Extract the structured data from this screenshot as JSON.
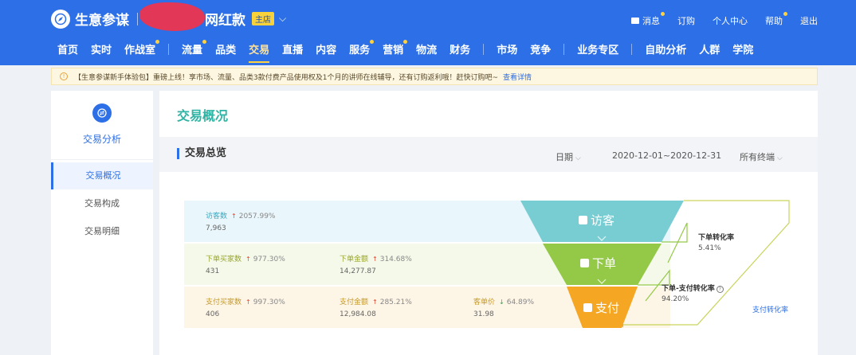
{
  "header": {
    "brand": "生意参谋",
    "shop_name_suffix": "网红款",
    "shop_badge": "主店",
    "user_nav": [
      "消息",
      "订购",
      "个人中心",
      "帮助",
      "退出"
    ]
  },
  "main_nav": {
    "group1": [
      "首页",
      "实时",
      "作战室"
    ],
    "group2": [
      "流量",
      "品类",
      "交易",
      "直播",
      "内容",
      "服务",
      "营销",
      "物流",
      "财务"
    ],
    "group3": [
      "市场",
      "竞争"
    ],
    "group4": [
      "业务专区"
    ],
    "group5": [
      "自助分析",
      "人群",
      "学院"
    ],
    "active": "交易"
  },
  "notice": {
    "text": "【生意参谋新手体验包】重磅上线！享市场、流量、品类3款付费产品使用权及1个月的讲师在线辅导，还有订购返利哦！赶快订购吧~",
    "link": "查看详情"
  },
  "sidebar": {
    "title": "交易分析",
    "items": [
      "交易概况",
      "交易构成",
      "交易明细"
    ],
    "active_index": 0
  },
  "content": {
    "page_title": "交易概况",
    "section_title": "交易总览",
    "filters": {
      "date_label": "日期",
      "date_range": "2020-12-01~2020-12-31",
      "terminal": "所有终端"
    },
    "rows": [
      {
        "metrics": [
          {
            "label": "访客数",
            "pct": "2057.99%",
            "trend": "up",
            "value": "7,963"
          }
        ]
      },
      {
        "metrics": [
          {
            "label": "下单买家数",
            "pct": "977.30%",
            "trend": "up",
            "value": "431"
          },
          {
            "label": "下单金额",
            "pct": "314.68%",
            "trend": "up",
            "value": "14,277.87"
          }
        ]
      },
      {
        "metrics": [
          {
            "label": "支付买家数",
            "pct": "997.30%",
            "trend": "up",
            "value": "406"
          },
          {
            "label": "支付金额",
            "pct": "285.21%",
            "trend": "up",
            "value": "12,984.08"
          },
          {
            "label": "客单价",
            "pct": "64.89%",
            "trend": "down",
            "value": "31.98"
          }
        ]
      }
    ],
    "funnel": {
      "stages": [
        "访客",
        "下单",
        "支付"
      ],
      "colors": [
        "#78cdd3",
        "#94c948",
        "#f5a623"
      ],
      "conversions": [
        {
          "label": "下单转化率",
          "value": "5.41%"
        },
        {
          "label": "下单-支付转化率",
          "value": "94.20%"
        },
        {
          "label": "支付转化率"
        }
      ]
    }
  }
}
